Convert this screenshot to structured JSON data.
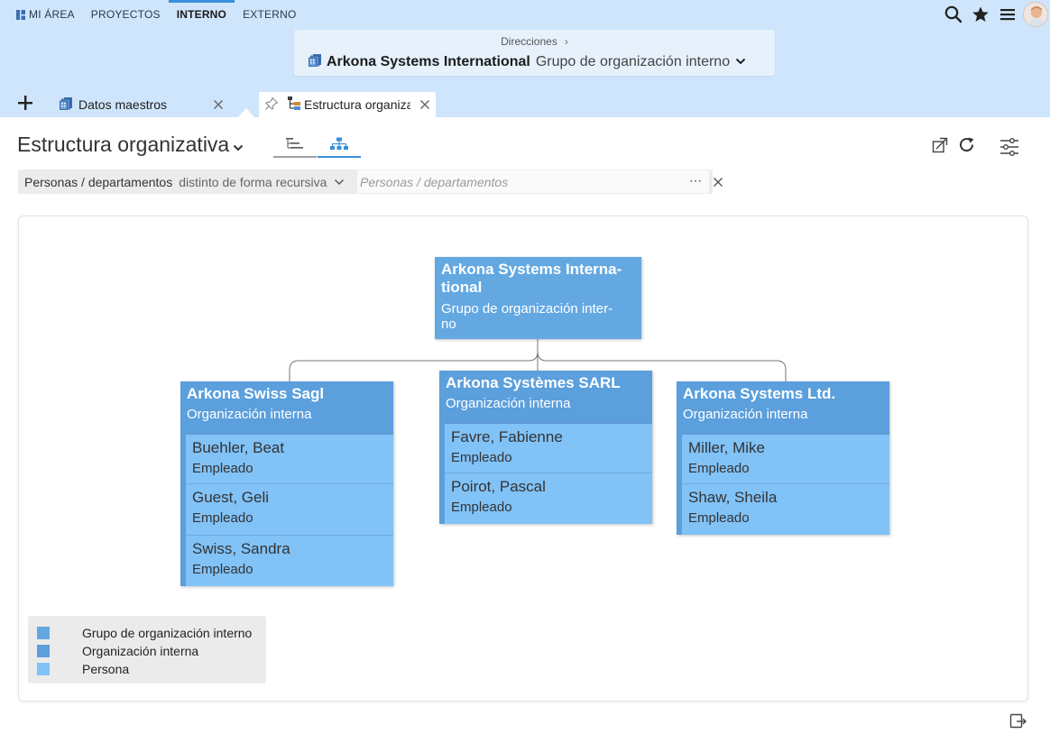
{
  "topnav": {
    "items": [
      {
        "label": "MI ÁREA"
      },
      {
        "label": "PROYECTOS"
      },
      {
        "label": "INTERNO"
      },
      {
        "label": "EXTERNO"
      }
    ],
    "active": "INTERNO"
  },
  "breadcrumb": {
    "parent": "Direcciones",
    "org_name": "Arkona Systems International",
    "org_type": "Grupo de organización interno"
  },
  "tabs": [
    {
      "label": "Datos maestros"
    },
    {
      "label": "Estructura organizativa"
    }
  ],
  "page": {
    "title": "Estructura organizativa"
  },
  "filter": {
    "field": "Personas / departamentos",
    "operator": "distinto de forma recursiva",
    "placeholder": "Personas / departamentos",
    "more": "⋯"
  },
  "org_chart": {
    "root": {
      "name_line1": "Arkona Systems Interna-",
      "name_line2": "tional",
      "type_line1": "Grupo de organización inter-",
      "type_line2": "no"
    },
    "departments": [
      {
        "name": "Arkona Swiss Sagl",
        "type": "Organización interna",
        "members": [
          {
            "name": "Buehler, Beat",
            "role": "Empleado"
          },
          {
            "name": "Guest, Geli",
            "role": "Empleado"
          },
          {
            "name": "Swiss, Sandra",
            "role": "Empleado"
          }
        ]
      },
      {
        "name": "Arkona Systèmes SARL",
        "type": "Organización interna",
        "members": [
          {
            "name": "Favre, Fabienne",
            "role": "Empleado"
          },
          {
            "name": "Poirot, Pascal",
            "role": "Empleado"
          }
        ]
      },
      {
        "name": "Arkona Systems Ltd.",
        "type": "Organización interna",
        "members": [
          {
            "name": "Miller, Mike",
            "role": "Empleado"
          },
          {
            "name": "Shaw, Sheila",
            "role": "Empleado"
          }
        ]
      }
    ]
  },
  "legend": [
    {
      "label": "Grupo de organización interno",
      "color": "#64a8e2"
    },
    {
      "label": "Organización interna",
      "color": "#5b9fdc"
    },
    {
      "label": "Persona",
      "color": "#81c2f7"
    }
  ],
  "colors": {
    "header_bg": "#cfe5fb",
    "accent": "#3b8fd8",
    "group_node": "#64a8e2",
    "org_node": "#5b9fdc",
    "person_node": "#81c2f7"
  }
}
